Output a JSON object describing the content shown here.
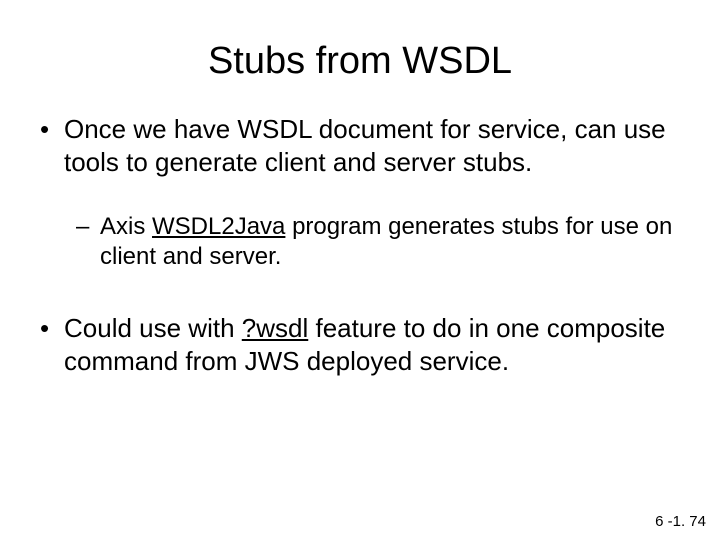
{
  "title": "Stubs from WSDL",
  "bullets": {
    "b1_pre": "Once we have WSDL document for service, can use tools to generate client and server stubs.",
    "b2_pre": "Axis ",
    "b2_underlined": "WSDL2Java",
    "b2_post": " program generates stubs for use on client and server.",
    "b3_pre": "Could use with ",
    "b3_underlined": "?wsdl",
    "b3_post": " feature to do in one composite command from JWS deployed service."
  },
  "footer": "6 -1. 74"
}
